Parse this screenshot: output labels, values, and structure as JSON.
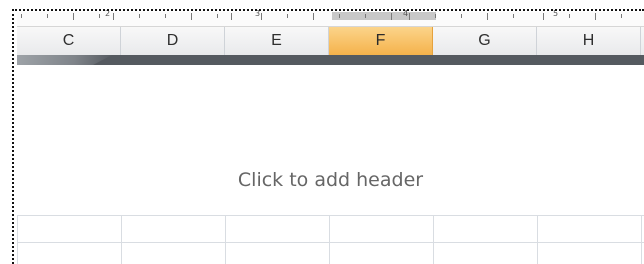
{
  "ruler": {
    "numbers": [
      "2",
      "3",
      "4",
      "5"
    ]
  },
  "columns": [
    {
      "label": "C",
      "selected": false
    },
    {
      "label": "D",
      "selected": false
    },
    {
      "label": "E",
      "selected": false
    },
    {
      "label": "F",
      "selected": true
    },
    {
      "label": "G",
      "selected": false
    },
    {
      "label": "H",
      "selected": false
    }
  ],
  "header": {
    "placeholder": "Click to add header"
  },
  "colors": {
    "selected_column": "#f5b24b",
    "page_edge": "#555a60",
    "gridline": "#d9dde2"
  }
}
